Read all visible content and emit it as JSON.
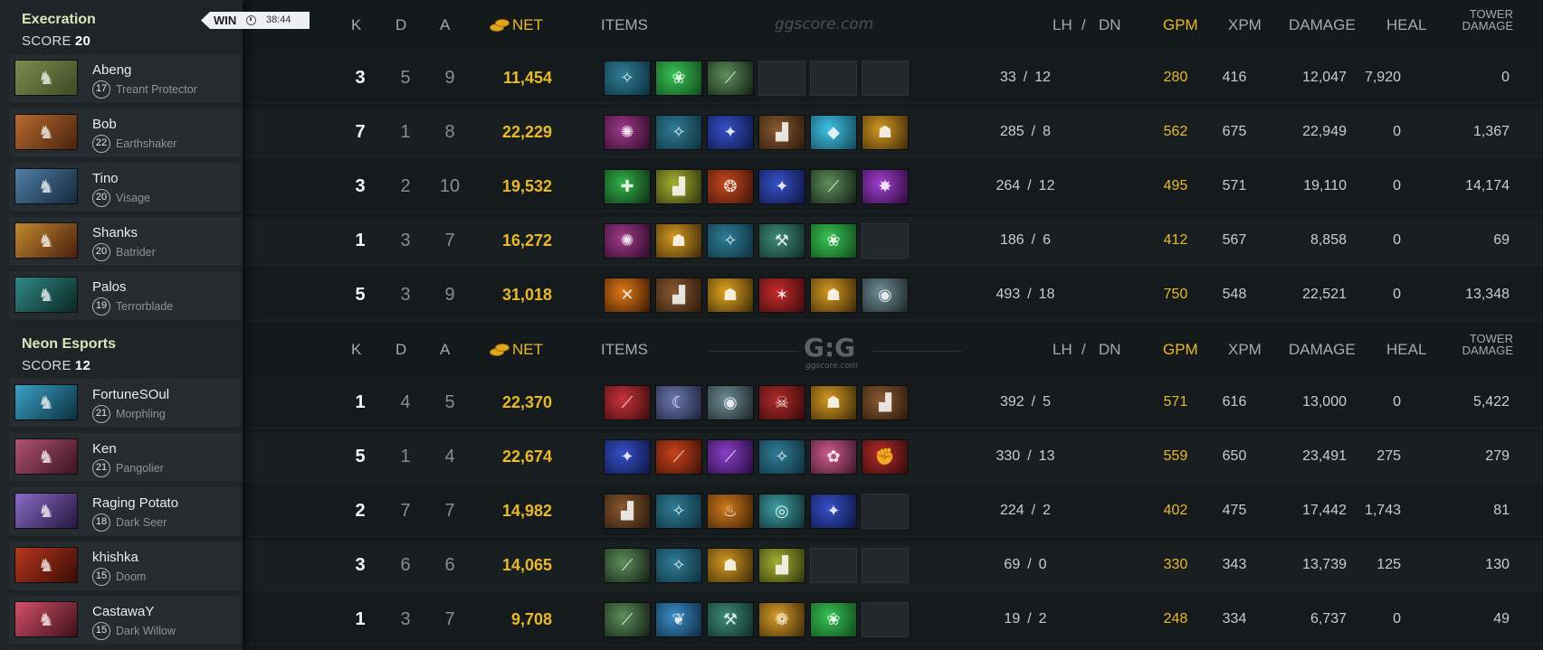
{
  "columns": {
    "k": "K",
    "d": "D",
    "a": "A",
    "net": "NET",
    "items": "ITEMS",
    "lh": "LH",
    "slash": "/",
    "dn": "DN",
    "gpm": "GPM",
    "xpm": "XPM",
    "damage": "DAMAGE",
    "heal": "HEAL",
    "tower_line1": "TOWER",
    "tower_line2": "DAMAGE"
  },
  "watermark": {
    "site": "ggscore.com",
    "logo": "G:G",
    "logo_sub": "ggscore.com"
  },
  "result": {
    "label": "WIN",
    "duration": "38:44"
  },
  "score_label": "SCORE",
  "colors": {
    "gold": "#e8b92a",
    "team_name": "#dde6b9",
    "background": "#14191c"
  },
  "teams": [
    {
      "name": "Execration",
      "score": "20",
      "players": [
        {
          "name": "Abeng",
          "level": "17",
          "hero": "Treant Protector",
          "portrait_colors": [
            "#7d8c4e",
            "#3e4a26"
          ],
          "portrait_icon": "tree-icon",
          "k": "3",
          "d": "5",
          "a": "9",
          "net": "11,454",
          "items": [
            {
              "icon": "blade-icon",
              "glyph": "✧",
              "colors": [
                "#2f7d96",
                "#0d2f3c"
              ]
            },
            {
              "icon": "boots-icon",
              "glyph": "❀",
              "colors": [
                "#39c254",
                "#0f4a1b"
              ]
            },
            {
              "icon": "wand-icon",
              "glyph": "⟋",
              "colors": [
                "#5d8f5a",
                "#121d13"
              ]
            },
            null,
            null,
            null
          ],
          "lh": "33",
          "dn": "12",
          "gpm": "280",
          "xpm": "416",
          "damage": "12,047",
          "heal": "7,920",
          "tower": "0"
        },
        {
          "name": "Bob",
          "level": "22",
          "hero": "Earthshaker",
          "portrait_colors": [
            "#b86b2e",
            "#4a2310"
          ],
          "portrait_icon": "totem-icon",
          "k": "7",
          "d": "1",
          "a": "8",
          "net": "22,229",
          "items": [
            {
              "icon": "orb-icon",
              "glyph": "✺",
              "colors": [
                "#a13a8c",
                "#2b0a26"
              ]
            },
            {
              "icon": "blade-icon",
              "glyph": "✧",
              "colors": [
                "#2f7d96",
                "#0d2f3c"
              ]
            },
            {
              "icon": "scepter-icon",
              "glyph": "✦",
              "colors": [
                "#3550c8",
                "#0e1542"
              ]
            },
            {
              "icon": "boots-icon",
              "glyph": "▟",
              "colors": [
                "#8a5a32",
                "#2a180a"
              ]
            },
            {
              "icon": "crystal-icon",
              "glyph": "◆",
              "colors": [
                "#3ec3e6",
                "#124656"
              ]
            },
            {
              "icon": "helm-icon",
              "glyph": "☗",
              "colors": [
                "#d49a22",
                "#3b2807"
              ]
            }
          ],
          "lh": "285",
          "dn": "8",
          "gpm": "562",
          "xpm": "675",
          "damage": "22,949",
          "heal": "0",
          "tower": "1,367"
        },
        {
          "name": "Tino",
          "level": "20",
          "hero": "Visage",
          "portrait_colors": [
            "#4f7fa8",
            "#15283a"
          ],
          "portrait_icon": "gargoyle-icon",
          "k": "3",
          "d": "2",
          "a": "10",
          "net": "19,532",
          "items": [
            {
              "icon": "gem-icon",
              "glyph": "✚",
              "colors": [
                "#33b24a",
                "#0d2e14"
              ]
            },
            {
              "icon": "boots-icon",
              "glyph": "▟",
              "colors": [
                "#a4b030",
                "#2f330c"
              ]
            },
            {
              "icon": "shield-icon",
              "glyph": "❂",
              "colors": [
                "#c4491d",
                "#3d1208"
              ]
            },
            {
              "icon": "scepter-icon",
              "glyph": "✦",
              "colors": [
                "#3550c8",
                "#0e1542"
              ]
            },
            {
              "icon": "wand-icon",
              "glyph": "⟋",
              "colors": [
                "#5d8f5a",
                "#121d13"
              ]
            },
            {
              "icon": "burst-icon",
              "glyph": "✸",
              "colors": [
                "#a33ed1",
                "#2a0b38"
              ]
            }
          ],
          "lh": "264",
          "dn": "12",
          "gpm": "495",
          "xpm": "571",
          "damage": "19,110",
          "heal": "0",
          "tower": "14,174"
        },
        {
          "name": "Shanks",
          "level": "20",
          "hero": "Batrider",
          "portrait_colors": [
            "#c28a2b",
            "#4a1d10"
          ],
          "portrait_icon": "rider-icon",
          "k": "1",
          "d": "3",
          "a": "7",
          "net": "16,272",
          "items": [
            {
              "icon": "orb-icon",
              "glyph": "✺",
              "colors": [
                "#a13a8c",
                "#2b0a26"
              ]
            },
            {
              "icon": "helm-icon",
              "glyph": "☗",
              "colors": [
                "#d49a22",
                "#3b2807"
              ]
            },
            {
              "icon": "blade-icon",
              "glyph": "✧",
              "colors": [
                "#2f7d96",
                "#0d2f3c"
              ]
            },
            {
              "icon": "staff-icon",
              "glyph": "⚒",
              "colors": [
                "#3f8c74",
                "#0f2a22"
              ]
            },
            {
              "icon": "boots-icon",
              "glyph": "❀",
              "colors": [
                "#39c254",
                "#0f4a1b"
              ]
            },
            null
          ],
          "lh": "186",
          "dn": "6",
          "gpm": "412",
          "xpm": "567",
          "damage": "8,858",
          "heal": "0",
          "tower": "69"
        },
        {
          "name": "Palos",
          "level": "19",
          "hero": "Terrorblade",
          "portrait_colors": [
            "#2f8a86",
            "#0c2624"
          ],
          "portrait_icon": "demon-icon",
          "k": "5",
          "d": "3",
          "a": "9",
          "net": "31,018",
          "items": [
            {
              "icon": "crossed-blades-icon",
              "glyph": "✕",
              "colors": [
                "#e07a16",
                "#3a1704"
              ]
            },
            {
              "icon": "boots-icon",
              "glyph": "▟",
              "colors": [
                "#8a5a32",
                "#2a180a"
              ]
            },
            {
              "icon": "helm-icon",
              "glyph": "☗",
              "colors": [
                "#e0a61f",
                "#3b2807"
              ]
            },
            {
              "icon": "claw-icon",
              "glyph": "✶",
              "colors": [
                "#c82b2b",
                "#3a0a0a"
              ]
            },
            {
              "icon": "helm-icon",
              "glyph": "☗",
              "colors": [
                "#d49a22",
                "#3b2807"
              ]
            },
            {
              "icon": "skull-icon",
              "glyph": "◉",
              "colors": [
                "#6f8d96",
                "#1b2427"
              ]
            }
          ],
          "lh": "493",
          "dn": "18",
          "gpm": "750",
          "xpm": "548",
          "damage": "22,521",
          "heal": "0",
          "tower": "13,348"
        }
      ]
    },
    {
      "name": "Neon Esports",
      "score": "12",
      "players": [
        {
          "name": "FortuneSOul",
          "level": "21",
          "hero": "Morphling",
          "portrait_colors": [
            "#3aa3c8",
            "#0c2f3e"
          ],
          "portrait_icon": "water-icon",
          "k": "1",
          "d": "4",
          "a": "5",
          "net": "22,370",
          "items": [
            {
              "icon": "sword-icon",
              "glyph": "⟋",
              "colors": [
                "#c8333a",
                "#3a0b0d"
              ]
            },
            {
              "icon": "moon-icon",
              "glyph": "☾",
              "colors": [
                "#6a78b0",
                "#1b2036"
              ]
            },
            {
              "icon": "skull-icon",
              "glyph": "◉",
              "colors": [
                "#6f8d96",
                "#1b2427"
              ]
            },
            {
              "icon": "mask-icon",
              "glyph": "☠",
              "colors": [
                "#b02a2a",
                "#350909"
              ]
            },
            {
              "icon": "helm-icon",
              "glyph": "☗",
              "colors": [
                "#d49a22",
                "#3b2807"
              ]
            },
            {
              "icon": "boots-icon",
              "glyph": "▟",
              "colors": [
                "#8a5a32",
                "#2a180a"
              ]
            }
          ],
          "lh": "392",
          "dn": "5",
          "gpm": "571",
          "xpm": "616",
          "damage": "13,000",
          "heal": "0",
          "tower": "5,422"
        },
        {
          "name": "Ken",
          "level": "21",
          "hero": "Pangolier",
          "portrait_colors": [
            "#b0546e",
            "#3a1420"
          ],
          "portrait_icon": "sword-icon",
          "k": "5",
          "d": "1",
          "a": "4",
          "net": "22,674",
          "items": [
            {
              "icon": "scepter-icon",
              "glyph": "✦",
              "colors": [
                "#3550c8",
                "#0e1542"
              ]
            },
            {
              "icon": "spear-icon",
              "glyph": "⟋",
              "colors": [
                "#c9431b",
                "#3c1006"
              ]
            },
            {
              "icon": "wand-icon",
              "glyph": "⟋",
              "colors": [
                "#8a3ec9",
                "#250c3a"
              ]
            },
            {
              "icon": "blade-icon",
              "glyph": "✧",
              "colors": [
                "#2f7d96",
                "#0d2f3c"
              ]
            },
            {
              "icon": "lotus-icon",
              "glyph": "✿",
              "colors": [
                "#d05c8e",
                "#3a1426"
              ]
            },
            {
              "icon": "gauntlet-icon",
              "glyph": "✊",
              "colors": [
                "#b52a2a",
                "#2e0a0a"
              ]
            }
          ],
          "lh": "330",
          "dn": "13",
          "gpm": "559",
          "xpm": "650",
          "damage": "23,491",
          "heal": "275",
          "tower": "279"
        },
        {
          "name": "Raging Potato",
          "level": "18",
          "hero": "Dark Seer",
          "portrait_colors": [
            "#8a6cc8",
            "#24173e"
          ],
          "portrait_icon": "seer-icon",
          "k": "2",
          "d": "7",
          "a": "7",
          "net": "14,982",
          "items": [
            {
              "icon": "boots-icon",
              "glyph": "▟",
              "colors": [
                "#8a5a32",
                "#2a180a"
              ]
            },
            {
              "icon": "blade-icon",
              "glyph": "✧",
              "colors": [
                "#2f7d96",
                "#0d2f3c"
              ]
            },
            {
              "icon": "lantern-icon",
              "glyph": "♨",
              "colors": [
                "#d07a1c",
                "#3a1f05"
              ]
            },
            {
              "icon": "orb-icon",
              "glyph": "◎",
              "colors": [
                "#3fa0a4",
                "#0e2a2c"
              ]
            },
            {
              "icon": "scepter-icon",
              "glyph": "✦",
              "colors": [
                "#3550c8",
                "#0e1542"
              ]
            },
            null
          ],
          "lh": "224",
          "dn": "2",
          "gpm": "402",
          "xpm": "475",
          "damage": "17,442",
          "heal": "1,743",
          "tower": "81"
        },
        {
          "name": "khishka",
          "level": "15",
          "hero": "Doom",
          "portrait_colors": [
            "#b8361e",
            "#3a0c05"
          ],
          "portrait_icon": "flame-icon",
          "k": "3",
          "d": "6",
          "a": "6",
          "net": "14,065",
          "items": [
            {
              "icon": "wand-icon",
              "glyph": "⟋",
              "colors": [
                "#5d8f5a",
                "#121d13"
              ]
            },
            {
              "icon": "blade-icon",
              "glyph": "✧",
              "colors": [
                "#2f7d96",
                "#0d2f3c"
              ]
            },
            {
              "icon": "helm-icon",
              "glyph": "☗",
              "colors": [
                "#d49a22",
                "#3b2807"
              ]
            },
            {
              "icon": "boots-icon",
              "glyph": "▟",
              "colors": [
                "#a4b030",
                "#2f330c"
              ]
            },
            null,
            null
          ],
          "lh": "69",
          "dn": "0",
          "gpm": "330",
          "xpm": "343",
          "damage": "13,739",
          "heal": "125",
          "tower": "130"
        },
        {
          "name": "CastawaY",
          "level": "15",
          "hero": "Dark Willow",
          "portrait_colors": [
            "#d4506a",
            "#3e1019"
          ],
          "portrait_icon": "fairy-icon",
          "k": "1",
          "d": "3",
          "a": "7",
          "net": "9,708",
          "items": [
            {
              "icon": "wand-icon",
              "glyph": "⟋",
              "colors": [
                "#5d8f5a",
                "#121d13"
              ]
            },
            {
              "icon": "dragon-icon",
              "glyph": "❦",
              "colors": [
                "#3b8fc9",
                "#0e2840"
              ]
            },
            {
              "icon": "staff-icon",
              "glyph": "⚒",
              "colors": [
                "#3f8c74",
                "#0f2a22"
              ]
            },
            {
              "icon": "bottle-icon",
              "glyph": "❁",
              "colors": [
                "#d9a02a",
                "#3b2607"
              ]
            },
            {
              "icon": "boots-icon",
              "glyph": "❀",
              "colors": [
                "#39c254",
                "#0f4a1b"
              ]
            },
            null
          ],
          "lh": "19",
          "dn": "2",
          "gpm": "248",
          "xpm": "334",
          "damage": "6,737",
          "heal": "0",
          "tower": "49"
        }
      ]
    }
  ]
}
